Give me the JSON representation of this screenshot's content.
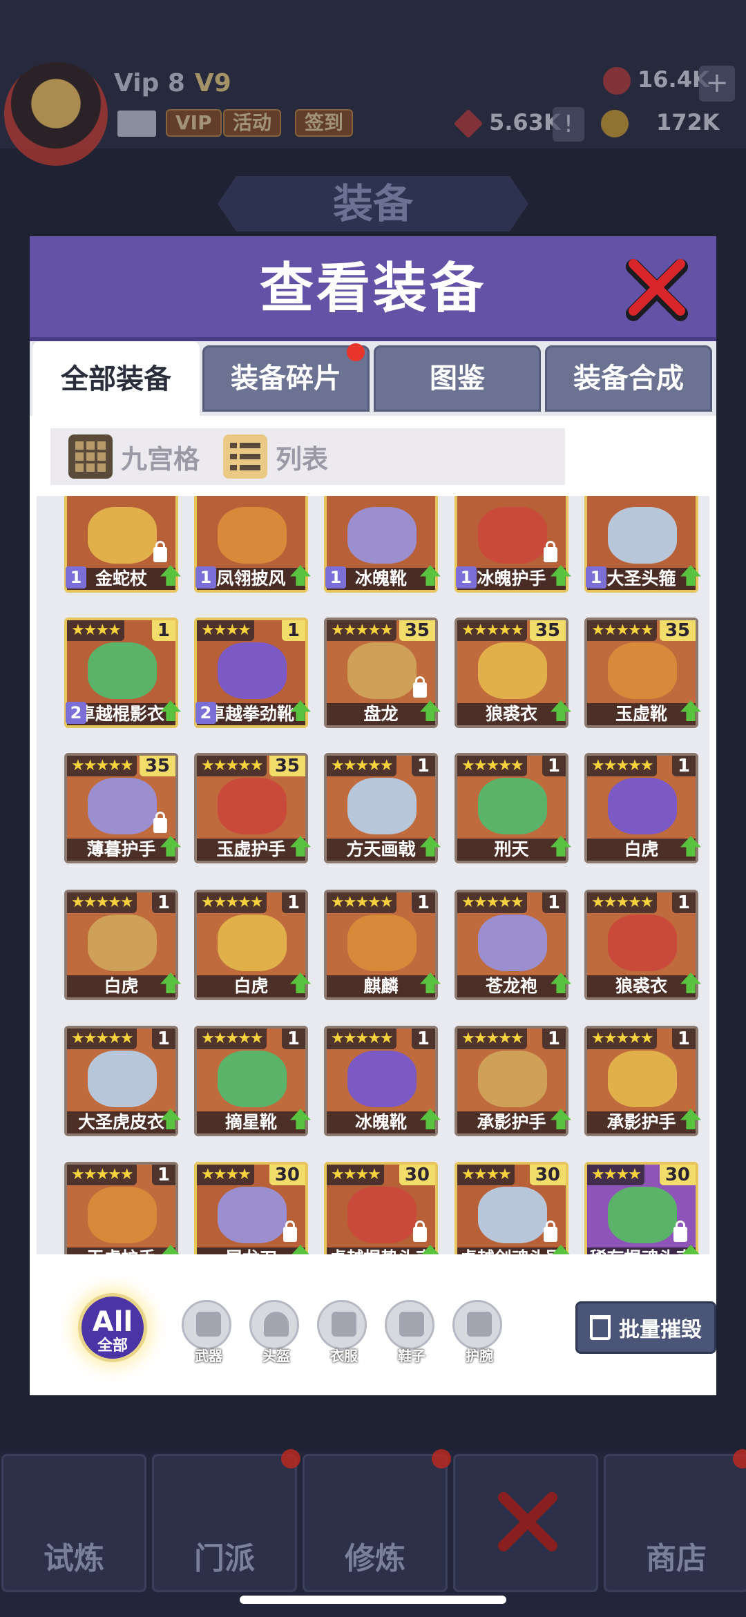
{
  "topbar": {
    "vip_label": "Vip 8",
    "vip_badge": "V9",
    "buttons": [
      "VIP",
      "活动",
      "签到"
    ],
    "gems": "16.4K",
    "tickets": "5.63K",
    "gold": "172K",
    "plus": "+",
    "excl": "!"
  },
  "page_title": "装备",
  "modal": {
    "title": "查看装备",
    "tabs": [
      "全部装备",
      "装备碎片",
      "图鉴",
      "装备合成"
    ],
    "view_modes": [
      "九宫格",
      "列表"
    ]
  },
  "items": [
    {
      "name": "金蛇杖",
      "stars": "",
      "level": "",
      "qty": "1",
      "lock": true,
      "frame": "gold"
    },
    {
      "name": "凤翎披风",
      "stars": "",
      "level": "",
      "qty": "1",
      "lock": false,
      "frame": "gold"
    },
    {
      "name": "冰魄靴",
      "stars": "",
      "level": "",
      "qty": "1",
      "lock": false,
      "frame": "gold"
    },
    {
      "name": "冰魄护手",
      "stars": "",
      "level": "",
      "qty": "1",
      "lock": true,
      "frame": "gold"
    },
    {
      "name": "大圣头箍",
      "stars": "",
      "level": "",
      "qty": "1",
      "lock": false,
      "frame": "gold"
    },
    {
      "name": "卓越棍影衣",
      "stars": "★★★★",
      "level": "1",
      "qty": "2",
      "lock": false,
      "frame": "gold"
    },
    {
      "name": "卓越拳劲靴",
      "stars": "★★★★",
      "level": "1",
      "qty": "2",
      "lock": false,
      "frame": "gold"
    },
    {
      "name": "盘龙",
      "stars": "★★★★★",
      "level": "35",
      "qty": "",
      "lock": true,
      "frame": "grey"
    },
    {
      "name": "狼裘衣",
      "stars": "★★★★★",
      "level": "35",
      "qty": "",
      "lock": false,
      "frame": "grey"
    },
    {
      "name": "玉虚靴",
      "stars": "★★★★★",
      "level": "35",
      "qty": "",
      "lock": false,
      "frame": "grey"
    },
    {
      "name": "薄暮护手",
      "stars": "★★★★★",
      "level": "35",
      "qty": "",
      "lock": true,
      "frame": "grey"
    },
    {
      "name": "玉虚护手",
      "stars": "★★★★★",
      "level": "35",
      "qty": "",
      "lock": false,
      "frame": "grey"
    },
    {
      "name": "方天画戟",
      "stars": "★★★★★",
      "level": "1",
      "qty": "",
      "lock": false,
      "frame": "grey"
    },
    {
      "name": "刑天",
      "stars": "★★★★★",
      "level": "1",
      "qty": "",
      "lock": false,
      "frame": "grey"
    },
    {
      "name": "白虎",
      "stars": "★★★★★",
      "level": "1",
      "qty": "",
      "lock": false,
      "frame": "grey"
    },
    {
      "name": "白虎",
      "stars": "★★★★★",
      "level": "1",
      "qty": "",
      "lock": false,
      "frame": "grey"
    },
    {
      "name": "白虎",
      "stars": "★★★★★",
      "level": "1",
      "qty": "",
      "lock": false,
      "frame": "grey"
    },
    {
      "name": "麒麟",
      "stars": "★★★★★",
      "level": "1",
      "qty": "",
      "lock": false,
      "frame": "grey"
    },
    {
      "name": "苍龙袍",
      "stars": "★★★★★",
      "level": "1",
      "qty": "",
      "lock": false,
      "frame": "grey"
    },
    {
      "name": "狼裘衣",
      "stars": "★★★★★",
      "level": "1",
      "qty": "",
      "lock": false,
      "frame": "grey"
    },
    {
      "name": "大圣虎皮衣",
      "stars": "★★★★★",
      "level": "1",
      "qty": "",
      "lock": false,
      "frame": "grey"
    },
    {
      "name": "摘星靴",
      "stars": "★★★★★",
      "level": "1",
      "qty": "",
      "lock": false,
      "frame": "grey"
    },
    {
      "name": "冰魄靴",
      "stars": "★★★★★",
      "level": "1",
      "qty": "",
      "lock": false,
      "frame": "grey"
    },
    {
      "name": "承影护手",
      "stars": "★★★★★",
      "level": "1",
      "qty": "",
      "lock": false,
      "frame": "grey"
    },
    {
      "name": "承影护手",
      "stars": "★★★★★",
      "level": "1",
      "qty": "",
      "lock": false,
      "frame": "grey"
    },
    {
      "name": "玉虚护手",
      "stars": "★★★★★",
      "level": "1",
      "qty": "",
      "lock": false,
      "frame": "grey"
    },
    {
      "name": "屠龙刀",
      "stars": "★★★★",
      "level": "30",
      "qty": "",
      "lock": true,
      "frame": "gold"
    },
    {
      "name": "卓越棍势头束",
      "stars": "★★★★",
      "level": "30",
      "qty": "",
      "lock": true,
      "frame": "gold"
    },
    {
      "name": "卓越剑魂头冠",
      "stars": "★★★★",
      "level": "30",
      "qty": "",
      "lock": true,
      "frame": "gold"
    },
    {
      "name": "稀有棍魂头束",
      "stars": "★★★★",
      "level": "30",
      "qty": "",
      "lock": true,
      "frame": "purple"
    }
  ],
  "filters": {
    "all_big": "All",
    "all_small": "全部",
    "categories": [
      "武器",
      "头盔",
      "衣服",
      "鞋子",
      "护腕"
    ],
    "batch_destroy": "批量摧毁"
  },
  "bottom_nav": [
    "试炼",
    "门派",
    "修炼",
    "",
    "商店"
  ],
  "colors": {
    "modal_header": "#6352a6",
    "active_tab": "#ffffff",
    "upgrade_arrow": "#59c23e",
    "star": "#f7d23c",
    "notify_dot": "#e8352b"
  }
}
